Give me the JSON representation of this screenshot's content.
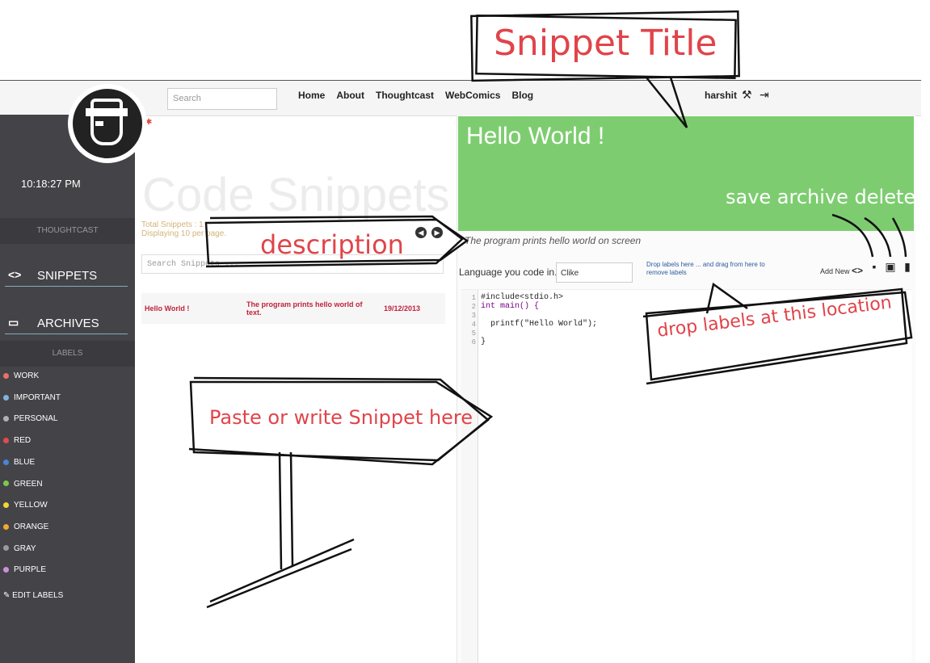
{
  "navbar": {
    "search_placeholder": "Search",
    "links": [
      "Home",
      "About",
      "Thoughtcast",
      "WebComics",
      "Blog"
    ],
    "user": "harshit"
  },
  "sidebar": {
    "time": "10:18:27 PM",
    "thoughtcast": "THOUGHTCAST",
    "snippets_label": "SNIPPETS",
    "archives_label": "ARCHIVES",
    "labels_header": "LABELS",
    "labels": [
      {
        "name": "WORK",
        "color": "#e8716b"
      },
      {
        "name": "IMPORTANT",
        "color": "#7fb3e0"
      },
      {
        "name": "PERSONAL",
        "color": "#b0b0b0"
      },
      {
        "name": "RED",
        "color": "#e34b4b"
      },
      {
        "name": "BLUE",
        "color": "#4a84d6"
      },
      {
        "name": "GREEN",
        "color": "#7cc94a"
      },
      {
        "name": "YELLOW",
        "color": "#f2d630"
      },
      {
        "name": "ORANGE",
        "color": "#f0a830"
      },
      {
        "name": "GRAY",
        "color": "#9a9a9a"
      },
      {
        "name": "PURPLE",
        "color": "#cf8fe0"
      }
    ],
    "edit_labels": "EDIT LABELS"
  },
  "snippets_list": {
    "heading": "Code Snippets",
    "total": "Total Snippets : 1",
    "displaying": "Displaying 10 per page.",
    "search_placeholder": "Search Snippets ...",
    "rows": [
      {
        "title": "Hello World !",
        "description": "The program prints hello world of text.",
        "date": "19/12/2013"
      }
    ]
  },
  "editor": {
    "title": "Hello World !",
    "description": "The program prints hello world on screen",
    "language_label": "Language you code in...",
    "language_value": "Clike",
    "drop_hint": "Drop labels here ... and drag from here to remove labels",
    "add_new": "Add New",
    "line_numbers": [
      "1",
      "2",
      "3",
      "4",
      "5",
      "6"
    ],
    "code_lines": [
      "#include<stdio.h>",
      "int main() {",
      "",
      "  printf(\"Hello World\");",
      "",
      "}"
    ]
  },
  "annotations": {
    "snippet_title": "Snippet Title",
    "save_archive_delete": "save archive delete",
    "description": "description",
    "drop_labels": "drop labels at this location",
    "paste_snippet": "Paste or write Snippet here"
  }
}
